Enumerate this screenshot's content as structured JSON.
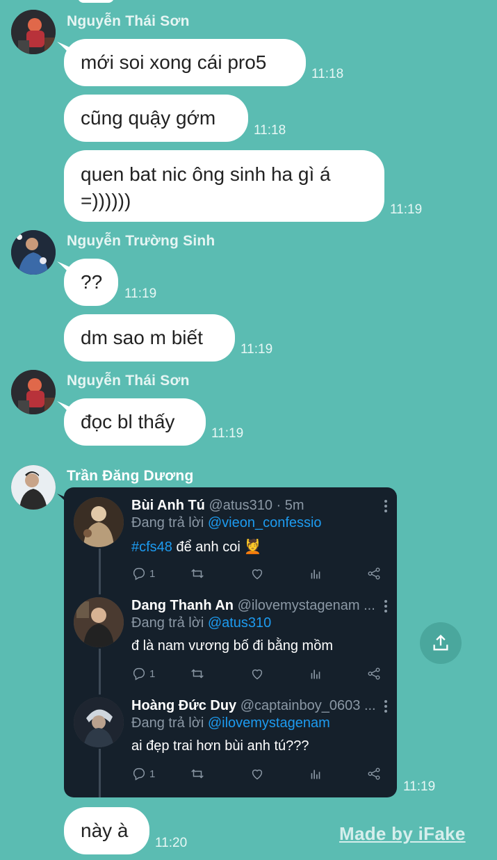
{
  "messages_group1": {
    "sender": "Nguyễn Thái Sơn",
    "bubbles": [
      {
        "text": "mới soi xong cái pro5",
        "time": "11:18"
      },
      {
        "text": "cũng quậy gớm",
        "time": "11:18"
      },
      {
        "text_line1": "quen bat nic ông sinh ha gì á",
        "text_line2": "=))))))",
        "time": "11:19"
      }
    ]
  },
  "messages_group2": {
    "sender": "Nguyễn Trường Sinh",
    "bubbles": [
      {
        "text": "??",
        "time": "11:19"
      },
      {
        "text": "dm sao m biết",
        "time": "11:19"
      }
    ]
  },
  "messages_group3": {
    "sender": "Nguyễn Thái Sơn",
    "bubbles": [
      {
        "text": "đọc bl thấy",
        "time": "11:19"
      }
    ]
  },
  "messages_group4": {
    "sender": "Trần Đăng Dương",
    "card_time": "11:19",
    "last_bubble": {
      "text": "này à",
      "time": "11:20"
    }
  },
  "tweets": [
    {
      "name": "Bùi Anh Tú",
      "handle": "@atus310 · 5m",
      "reply_prefix": "Đang trả lời ",
      "reply_to": "@vieon_confessio",
      "hashtag": "#cfs48",
      "text": " để anh coi 💆",
      "reply_count": "1"
    },
    {
      "name": "Dang Thanh An",
      "handle": "@ilovemystagenam ...",
      "reply_prefix": "Đang trả lời ",
      "reply_to": "@atus310",
      "text": "đ là nam vương bố đi bằng mồm",
      "reply_count": "1"
    },
    {
      "name": "Hoàng Đức Duy",
      "handle": "@captainboy_0603 ...",
      "reply_prefix": "Đang trả lời ",
      "reply_to": "@ilovemystagenam",
      "text": "ai đẹp trai hơn bùi anh tú???",
      "reply_count": "1"
    }
  ],
  "icons": {
    "share_fab": "share-upload-icon",
    "reply": "comment-icon",
    "retweet": "retweet-icon",
    "like": "heart-icon",
    "stats": "analytics-icon",
    "share": "share-icon"
  },
  "colors": {
    "background": "#5bbcb2",
    "bubble": "#ffffff",
    "card": "#15202b",
    "mention": "#1d9bf0"
  },
  "watermark": "Made by iFake"
}
